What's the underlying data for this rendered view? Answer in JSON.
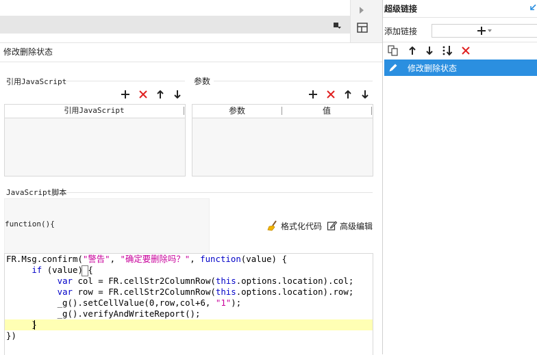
{
  "left": {
    "section_title": "修改删除状态",
    "ref_js": {
      "title": "引用JavaScript",
      "column": "引用JavaScript"
    },
    "params": {
      "title": "参数",
      "columns": [
        "参数",
        "值"
      ]
    },
    "script": {
      "title": "JavaScript脚本",
      "function_header": "function(){",
      "format_label": "格式化代码",
      "advanced_label": "高级编辑"
    }
  },
  "right": {
    "title": "超级链接",
    "add_label": "添加链接",
    "list": [
      {
        "label": "修改删除状态",
        "selected": true
      }
    ]
  },
  "code": [
    [
      [
        "FR.Msg.confirm(",
        ""
      ],
      [
        "\"警告\"",
        "str"
      ],
      [
        ", ",
        ""
      ],
      [
        "\"确定要删除吗？\"",
        "str"
      ],
      [
        ", ",
        ""
      ],
      [
        "function",
        "kw"
      ],
      [
        "(value) {",
        ""
      ]
    ],
    [
      [
        "     ",
        ""
      ],
      [
        "if",
        "kw"
      ],
      [
        " (value) {",
        ""
      ]
    ],
    [
      [
        "          ",
        ""
      ],
      [
        "var",
        "kw"
      ],
      [
        " col = FR.cellStr2ColumnRow(",
        ""
      ],
      [
        "this",
        "kw"
      ],
      [
        ".options.location).col;",
        ""
      ]
    ],
    [
      [
        "          ",
        ""
      ],
      [
        "var",
        "kw"
      ],
      [
        " row = FR.cellStr2ColumnRow(",
        ""
      ],
      [
        "this",
        "kw"
      ],
      [
        ".options.location).row;",
        ""
      ]
    ],
    [
      [
        "          _g().setCellValue(0,row,col+6, ",
        ""
      ],
      [
        "\"1\"",
        "str"
      ],
      [
        ");",
        ""
      ]
    ],
    [
      [
        "          _g().verifyAndWriteReport();",
        ""
      ]
    ],
    [
      [
        "     }",
        ""
      ]
    ],
    [
      [
        "})",
        ""
      ]
    ]
  ],
  "colors": {
    "accent": "#2b8fe0",
    "delete": "#e02020",
    "highlight": "#ffffb4"
  }
}
